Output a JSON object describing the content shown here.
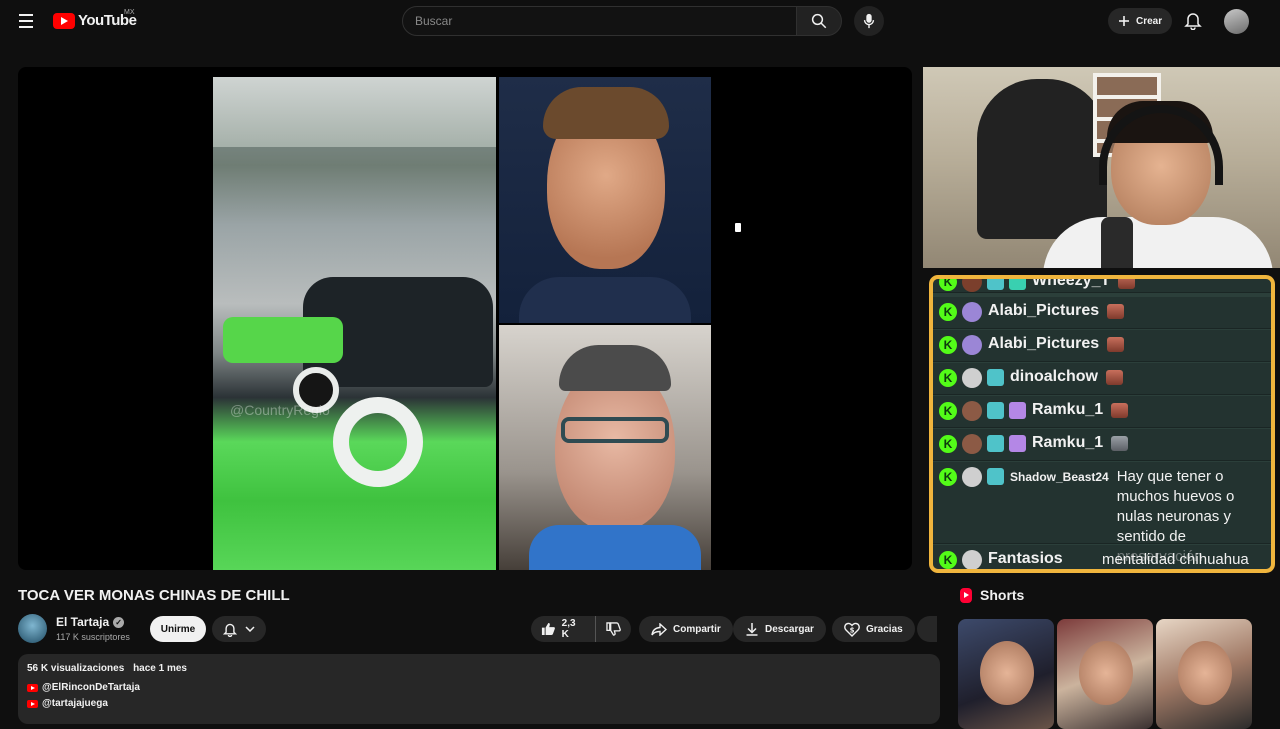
{
  "header": {
    "logo_text": "YouTube",
    "region": "MX",
    "search_placeholder": "Buscar",
    "create_label": "Crear"
  },
  "player": {
    "watermark": "@CountryRegio"
  },
  "chat": {
    "messages": [
      {
        "user": "Wheezy_T",
        "text": ""
      },
      {
        "user": "Alabi_Pictures",
        "text": ""
      },
      {
        "user": "Alabi_Pictures",
        "text": ""
      },
      {
        "user": "dinoalchow",
        "text": ""
      },
      {
        "user": "Ramku_1",
        "text": ""
      },
      {
        "user": "Ramku_1",
        "text": ""
      },
      {
        "user": "Shadow_Beast24",
        "text": "Hay que tener o muchos huevos o nulas neuronas y sentido de preservación"
      },
      {
        "user": "Fantasios",
        "text": "mentalidad chihuahua"
      }
    ]
  },
  "video": {
    "title": "TOCA VER MONAS CHINAS DE CHILL",
    "channel_name": "El Tartaja",
    "subscribers": "117 K suscriptores",
    "join_label": "Unirme",
    "likes": "2,3 K",
    "share_label": "Compartir",
    "download_label": "Descargar",
    "thanks_label": "Gracias"
  },
  "description": {
    "views": "56 K visualizaciones",
    "date": "hace 1 mes",
    "links": [
      "@ElRinconDeTartaja",
      "@tartajajuega"
    ]
  },
  "shorts": {
    "heading": "Shorts"
  },
  "colors": {
    "chat_border": "#f0b53d",
    "kick_green": "#53fc18",
    "youtube_red": "#ff0000"
  }
}
